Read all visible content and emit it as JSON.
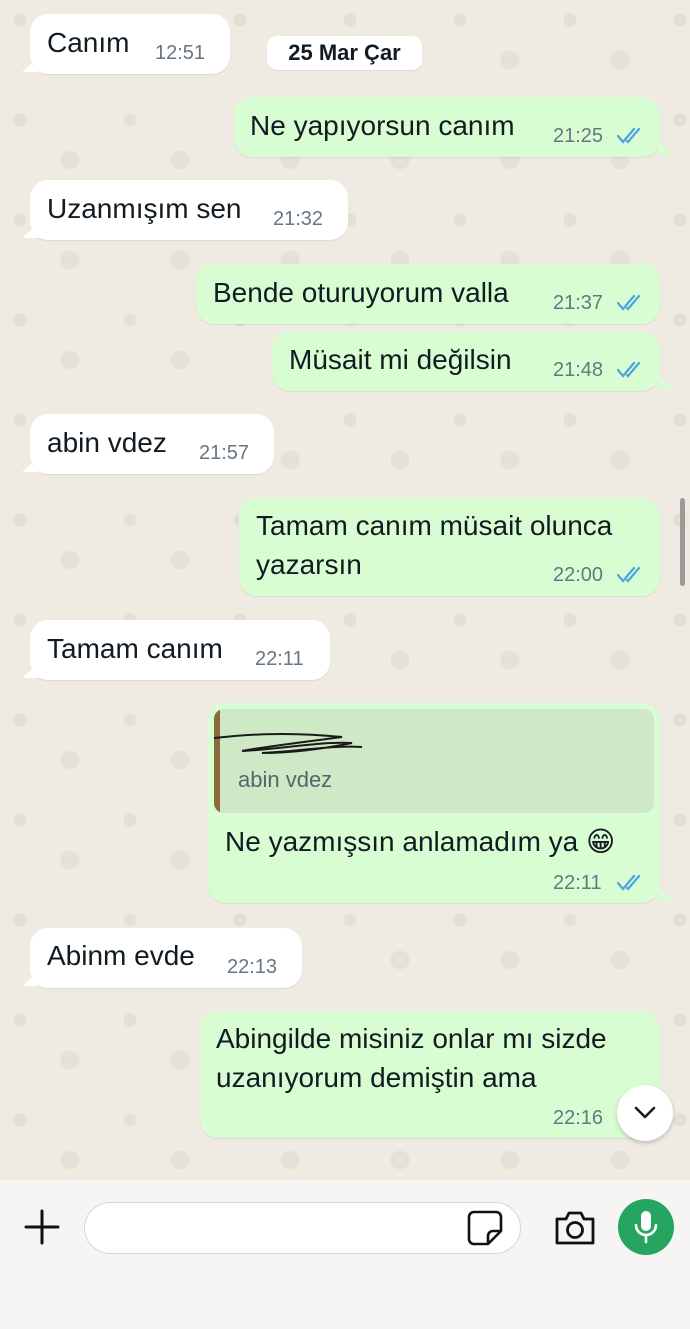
{
  "date_separator": "25 Mar Çar",
  "messages": [
    {
      "text": "Canım",
      "time": "12:51"
    },
    {
      "text": "Ne yapıyorsun canım",
      "time": "21:25"
    },
    {
      "text": "Uzanmışım sen",
      "time": "21:32"
    },
    {
      "text": "Bende oturuyorum valla",
      "time": "21:37"
    },
    {
      "text": "Müsait mi değilsin",
      "time": "21:48"
    },
    {
      "text": "abin vdez",
      "time": "21:57"
    },
    {
      "text_line1": "Tamam canım müsait olunca",
      "text_line2": "yazarsın",
      "time": "22:00"
    },
    {
      "text": "Tamam canım",
      "time": "22:11"
    },
    {
      "quote_text": "abin vdez",
      "text": "Ne yazmışsın anlamadım ya 😁",
      "time": "22:11"
    },
    {
      "text": "Abinm evde",
      "time": "22:13"
    },
    {
      "text_line1": "Abingilde misiniz onlar mı sizde",
      "text_line2": "uzanıyorum demiştin ama",
      "time": "22:16"
    }
  ],
  "composer": {
    "value": ""
  },
  "icons": {
    "plus": "plus-icon",
    "sticker": "sticker-icon",
    "camera": "camera-icon",
    "mic": "microphone-icon",
    "scroll_down": "chevron-down-icon",
    "read_receipt": "double-check-icon"
  },
  "colors": {
    "incoming_bubble": "#ffffff",
    "outgoing_bubble": "#d9fdd3",
    "read_ticks": "#4fa3e0",
    "mic_button": "#25a55f",
    "quote_bar": "#8b6a3b"
  }
}
